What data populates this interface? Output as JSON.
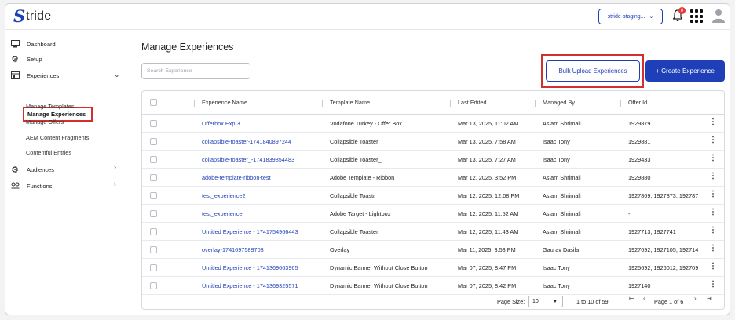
{
  "header": {
    "logo_mark": "S",
    "logo_text": "tride",
    "env_select": "stride-staging...",
    "notification_count": "0"
  },
  "sidebar": {
    "dashboard": "Dashboard",
    "setup": "Setup",
    "experiences": "Experiences",
    "sub_items": [
      "Manage Experiences",
      "Manage Templates",
      "Manage Offers",
      "AEM Content Fragments",
      "Contentful Entries"
    ],
    "audiences": "Audiences",
    "functions": "Functions"
  },
  "main": {
    "title": "Manage Experiences",
    "search_placeholder": "Search Experience",
    "bulk_upload_label": "Bulk Upload Experiences",
    "create_label": "+ Create Experience"
  },
  "table": {
    "columns": [
      "Experience Name",
      "Template Name",
      "Last Edited",
      "Managed By",
      "Offer Id"
    ],
    "sort_icon": "arrow-down-icon",
    "rows": [
      [
        "Offerbox Exp 3",
        "Vodafone Turkey - Offer Box",
        "Mar 13, 2025, 11:02 AM",
        "Aslam Shrimali",
        "1929879"
      ],
      [
        "collapsible-toaster-1741840897244",
        "Collapsible Toaster",
        "Mar 13, 2025, 7:58 AM",
        "Isaac Tony",
        "1929881"
      ],
      [
        "collapsible-toaster_-1741839854483",
        "Collapsible Toaster_",
        "Mar 13, 2025, 7:27 AM",
        "Isaac Tony",
        "1929433"
      ],
      [
        "adobe-template-ribbon-test",
        "Adobe Template - Ribbon",
        "Mar 12, 2025, 3:52 PM",
        "Aslam Shrimali",
        "1929880"
      ],
      [
        "test_experience2",
        "Collapsible Toastr",
        "Mar 12, 2025, 12:08 PM",
        "Aslam Shrimali",
        "1927869, 1927873, 192787"
      ],
      [
        "test_experience",
        "Adobe Target - Lightbox",
        "Mar 12, 2025, 11:52 AM",
        "Aslam Shrimali",
        "-"
      ],
      [
        "Untitled Experience - 1741754966443",
        "Collapsible Toaster",
        "Mar 12, 2025, 11:43 AM",
        "Aslam Shrimali",
        "1927713, 1927741"
      ],
      [
        "overlay-1741697589703",
        "Overlay",
        "Mar 11, 2025, 3:53 PM",
        "Gaurav Dasila",
        "1927092, 1927105, 192714"
      ],
      [
        "Untitled Experience - 1741369663965",
        "Dynamic Banner Without Close Button",
        "Mar 07, 2025, 8:47 PM",
        "Isaac Tony",
        "1925692, 1926012, 192709"
      ],
      [
        "Untitled Experience - 1741369325571",
        "Dynamic Banner Without Close Button",
        "Mar 07, 2025, 8:42 PM",
        "Isaac Tony",
        "1927140"
      ]
    ]
  },
  "pagination": {
    "page_size_label": "Page Size:",
    "page_size": "10",
    "range": "1 to 10 of 59",
    "page": "Page 1 of 6"
  }
}
